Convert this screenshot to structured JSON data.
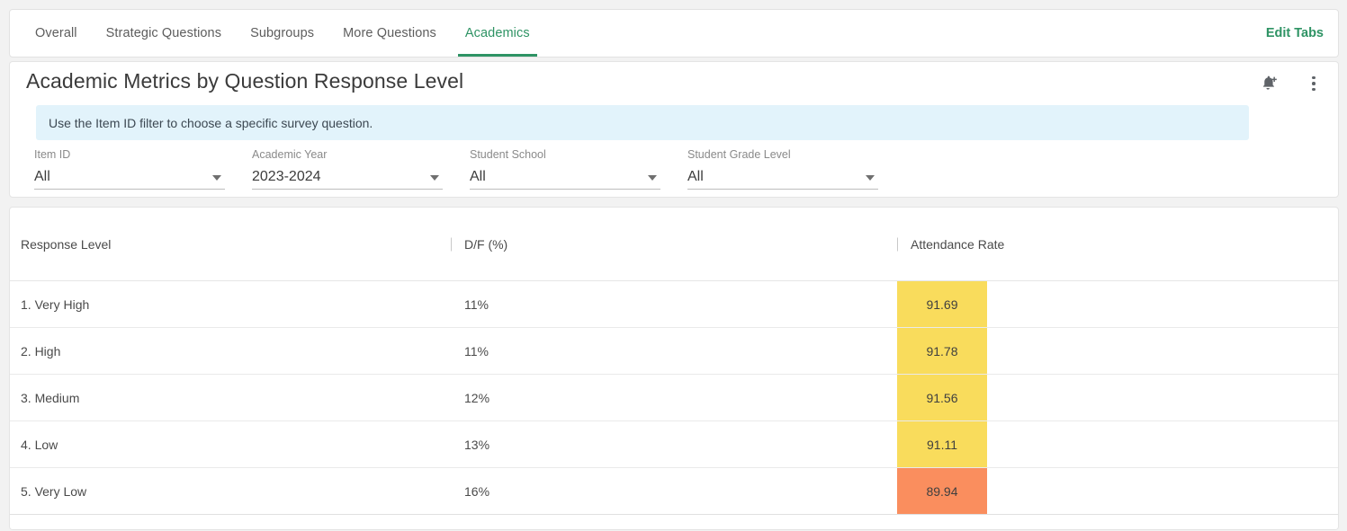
{
  "tabs": {
    "items": [
      {
        "label": "Overall",
        "active": false
      },
      {
        "label": "Strategic Questions",
        "active": false
      },
      {
        "label": "Subgroups",
        "active": false
      },
      {
        "label": "More Questions",
        "active": false
      },
      {
        "label": "Academics",
        "active": true
      }
    ],
    "edit_label": "Edit Tabs"
  },
  "panel": {
    "title": "Academic Metrics by Question Response Level",
    "info_text": "Use the Item ID filter to choose a specific survey question.",
    "icons": {
      "alert": "add-alert-bell-icon",
      "menu": "kebab-menu-icon"
    }
  },
  "filters": [
    {
      "label": "Item ID",
      "value": "All"
    },
    {
      "label": "Academic Year",
      "value": "2023-2024"
    },
    {
      "label": "Student School",
      "value": "All"
    },
    {
      "label": "Student Grade Level",
      "value": "All"
    }
  ],
  "table": {
    "columns": [
      "Response Level",
      "D/F (%)",
      "Attendance Rate"
    ],
    "rows": [
      {
        "level": "1. Very High",
        "df": "11%",
        "attendance": "91.69",
        "color": "#f9dc5c"
      },
      {
        "level": "2. High",
        "df": "11%",
        "attendance": "91.78",
        "color": "#f9dc5c"
      },
      {
        "level": "3. Medium",
        "df": "12%",
        "attendance": "91.56",
        "color": "#f9dc5c"
      },
      {
        "level": "4. Low",
        "df": "13%",
        "attendance": "91.11",
        "color": "#f9dc5c"
      },
      {
        "level": "5. Very Low",
        "df": "16%",
        "attendance": "89.94",
        "color": "#fa8e5e"
      }
    ]
  },
  "colors": {
    "accent_green": "#2e9364",
    "info_bg": "#e2f3fb",
    "heat_yellow": "#f9dc5c",
    "heat_orange": "#fa8e5e"
  }
}
